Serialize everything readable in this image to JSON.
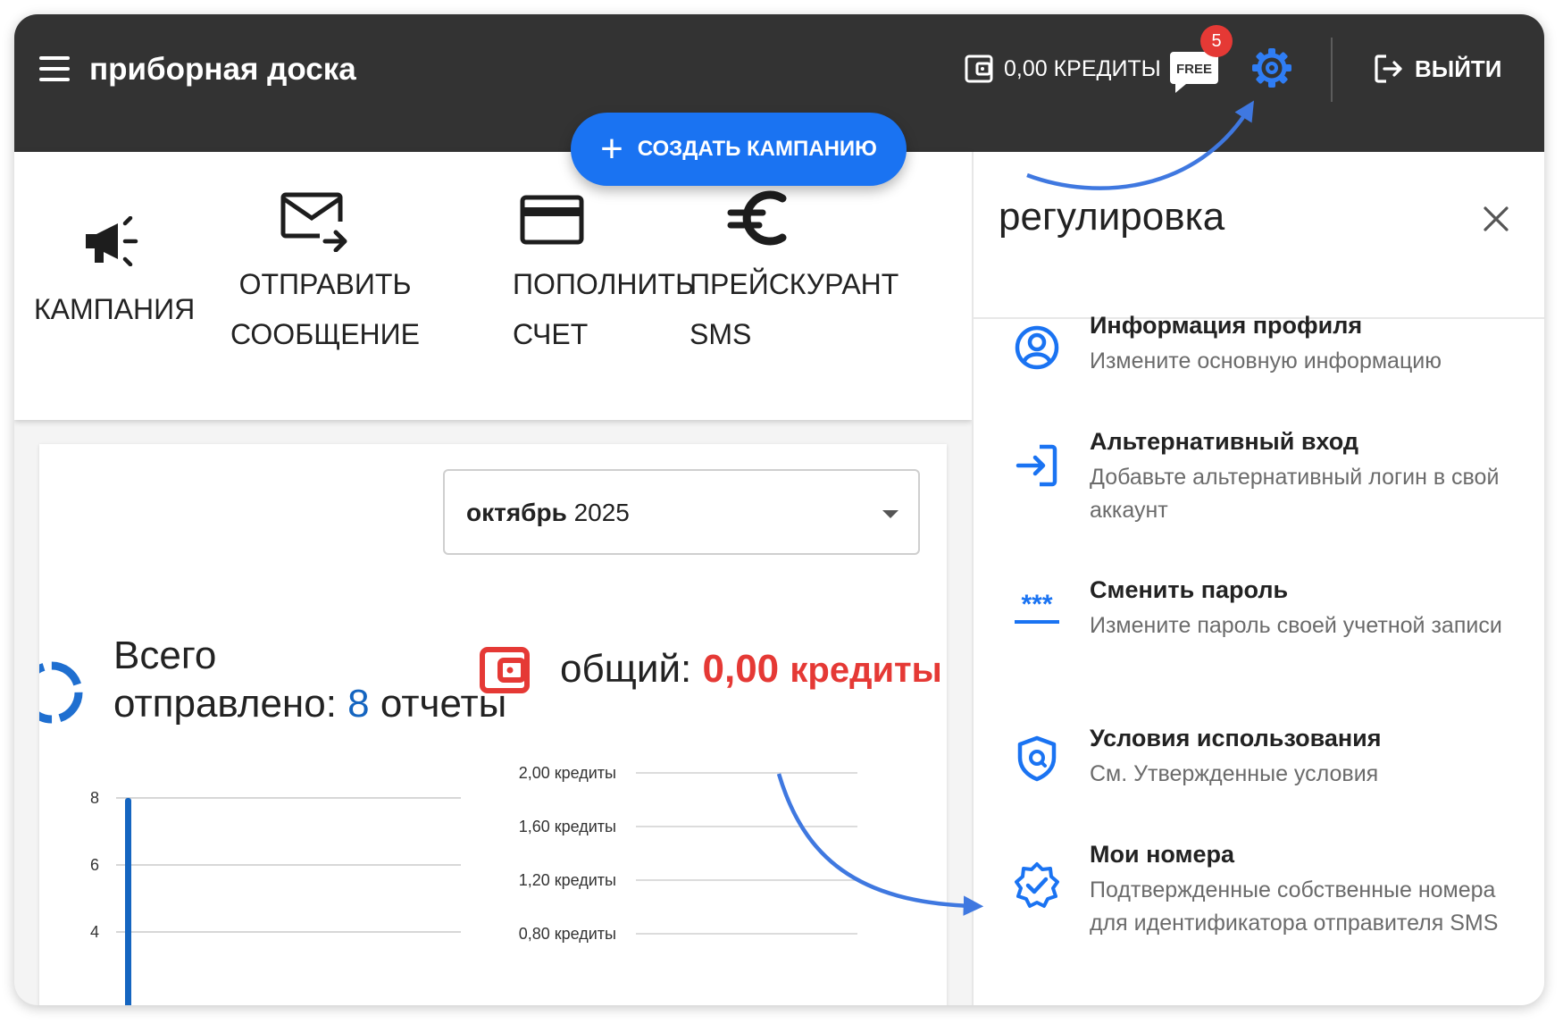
{
  "header": {
    "title": "приборная доска",
    "credits": "0,00 КРЕДИТЫ",
    "free_label": "FREE",
    "notification_count": "5",
    "logout_label": "ВЫЙТИ"
  },
  "fab": {
    "label": "СОЗДАТЬ КАМПАНИЮ"
  },
  "actions": [
    {
      "line1": "КАМПАНИЯ",
      "line2": ""
    },
    {
      "line1": "ОТПРАВИТЬ",
      "line2": "СООБЩЕНИЕ"
    },
    {
      "line1": "ПОПОЛНИТЬ",
      "line2": "СЧЕТ"
    },
    {
      "line1": "ПРЕЙСКУРАНТ",
      "line2": "SMS"
    }
  ],
  "month_select": {
    "label": "октябрь",
    "year": "2025"
  },
  "stats": {
    "sent_line1": "Всего",
    "sent_line2": "отправлено:",
    "sent_count": "8",
    "sent_unit": "отчеты",
    "total_label": "общий:",
    "total_amount": "0,00",
    "total_unit": "кредиты"
  },
  "panel": {
    "title": "регулировка",
    "items": [
      {
        "title": "Информация профиля",
        "desc": "Измените основную информацию",
        "icon": "profile-icon"
      },
      {
        "title": "Альтернативный вход",
        "desc": "Добавьте альтернативный логин в свой аккаунт",
        "icon": "login-icon"
      },
      {
        "title": "Сменить пароль",
        "desc": "Измените пароль своей учетной записи",
        "icon": "password-icon"
      },
      {
        "title": "Условия использования",
        "desc": "См. Утвержденные условия",
        "icon": "shield-icon"
      },
      {
        "title": "Мои номера",
        "desc": "Подтвержденные собственные номера для идентификатора отправителя SMS",
        "icon": "verified-badge-icon"
      }
    ]
  },
  "colors": {
    "accent": "#1a73f2",
    "topbar": "#333333",
    "alert": "#e53935",
    "series": "#1565c0"
  },
  "chart_data": [
    {
      "type": "bar",
      "ytick_labels": [
        "8",
        "6",
        "4"
      ],
      "yticks": [
        8,
        6,
        4
      ],
      "values": [
        8
      ],
      "ylim": [
        4,
        8
      ]
    },
    {
      "type": "line",
      "ytick_labels": [
        "2,00 кредиты",
        "1,60 кредиты",
        "1,20 кредиты",
        "0,80 кредиты"
      ],
      "yticks": [
        2.0,
        1.6,
        1.2,
        0.8
      ],
      "ylim": [
        0.8,
        2.0
      ]
    }
  ]
}
